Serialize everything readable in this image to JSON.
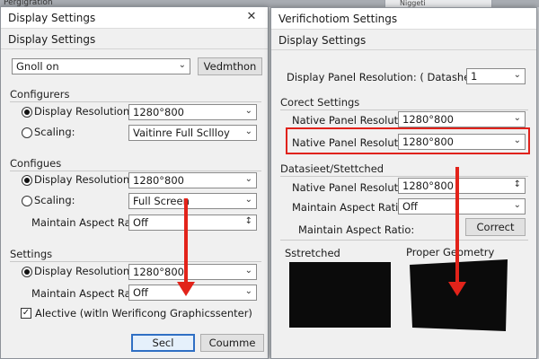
{
  "background": {
    "top_label": "Pergigration",
    "tab_label": "Niggeti"
  },
  "left_window": {
    "title": "Display Settings",
    "close_glyph": "✕",
    "subheader": "Display Settings",
    "top_combo": {
      "value": "Gnoll on"
    },
    "top_button": "Vedmthon",
    "groups": [
      {
        "title": "Configurers",
        "rows": [
          {
            "label": "Display Resolution:",
            "value": "1280°800",
            "radio": "selected"
          },
          {
            "label": "Scaling:",
            "value": "Vaitinre Full Scllloy",
            "radio": "unselected"
          }
        ]
      },
      {
        "title": "Configues",
        "rows": [
          {
            "label": "Display Resolution:",
            "value": "1280°800",
            "radio": "selected"
          },
          {
            "label": "Scaling:",
            "value": "Full Screen",
            "radio": "unselected"
          },
          {
            "label": "Maintain Aspect Ratio:",
            "value": "Off"
          }
        ]
      },
      {
        "title": "Settings",
        "rows": [
          {
            "label": "Display Resolution:",
            "value": "1280°800",
            "radio": "selected"
          },
          {
            "label": "Maintain Aspect Ratio:",
            "value": "Off"
          }
        ]
      }
    ],
    "checkbox": {
      "label": "Alective (witln Werificong Graphicssenter)",
      "checked": true,
      "glyph": "✓"
    },
    "buttons": {
      "primary": "Secl",
      "secondary": "Coumme"
    }
  },
  "right_window": {
    "title": "Verifichotiom Settings",
    "subheader": "Display Settings",
    "panel_res": {
      "label": "Display Panel Resolution: ( Datasheet",
      "value": "1"
    },
    "correct_group": {
      "title": "Corect Settings",
      "rows": [
        {
          "label": "Native Panel Resolution:",
          "value": "1280°800"
        },
        {
          "label": "Native Panel Resolution:",
          "value": "1280°800"
        }
      ]
    },
    "datasheet_group": {
      "title": "Datasieet/Stettched",
      "rows": [
        {
          "label": "Native Panel Resolution:",
          "value": "1280°800"
        },
        {
          "label": "Maintain Aspect Ratio:",
          "value": "Off"
        },
        {
          "label": "Maintain Aspect Ratio:",
          "button": "Correct"
        }
      ]
    },
    "preview_stretched": "Sstretched",
    "preview_proper": "Proper Geometry"
  },
  "glyphs": {
    "chevron": "⌄",
    "spin": "↕"
  },
  "colors": {
    "highlight": "#e0221b",
    "arrow": "#e2231a",
    "default_button_border": "#2f6fc4"
  }
}
